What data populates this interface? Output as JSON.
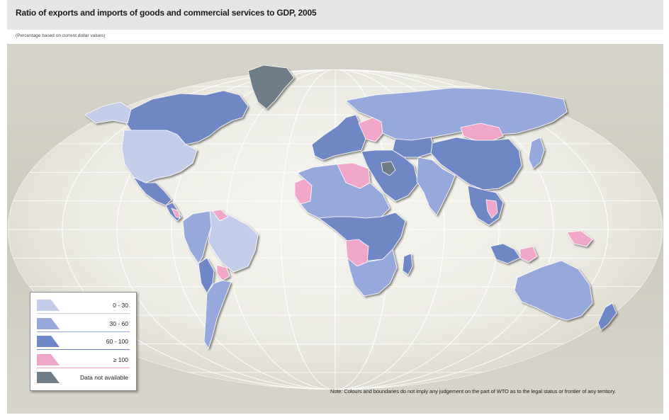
{
  "title": "Ratio of exports and imports of goods and commercial services to GDP, 2005",
  "subtitle": "(Percentage based on current dollar values)",
  "legend": [
    {
      "label": "0 - 30",
      "color": "#c3cdea"
    },
    {
      "label": "30 - 60",
      "color": "#97a9dc"
    },
    {
      "label": "60 - 100",
      "color": "#6f87c6"
    },
    {
      "label": "≥ 100",
      "color": "#f0a6c8"
    },
    {
      "label": "Data not available",
      "color": "#6e7d87"
    }
  ],
  "note": "Note: Colours and boundaries do not imply any judgement on the part of WTO as to the legal status or frontier of any territory.",
  "map": {
    "background": "#d4d1c6",
    "ocean_gradient_light": "#f4f3ee",
    "regions": [
      {
        "name": "greenland",
        "class": "Data not available"
      },
      {
        "name": "canada",
        "class": "60 - 100"
      },
      {
        "name": "alaska",
        "class": "0 - 30"
      },
      {
        "name": "united-states",
        "class": "0 - 30"
      },
      {
        "name": "mexico",
        "class": "60 - 100"
      },
      {
        "name": "central-america",
        "class": "60 - 100"
      },
      {
        "name": "central-america-high",
        "class": "≥ 100"
      },
      {
        "name": "brazil",
        "class": "0 - 30"
      },
      {
        "name": "south-america-west",
        "class": "30 - 60"
      },
      {
        "name": "andes",
        "class": "60 - 100"
      },
      {
        "name": "argentina",
        "class": "30 - 60"
      },
      {
        "name": "paraguay",
        "class": "≥ 100"
      },
      {
        "name": "guyana",
        "class": "≥ 100"
      },
      {
        "name": "europe-west",
        "class": "60 - 100"
      },
      {
        "name": "europe-east",
        "class": "≥ 100"
      },
      {
        "name": "russia",
        "class": "30 - 60"
      },
      {
        "name": "middle-east",
        "class": "60 - 100"
      },
      {
        "name": "iraq",
        "class": "Data not available"
      },
      {
        "name": "libya",
        "class": "≥ 100"
      },
      {
        "name": "mauritania",
        "class": "≥ 100"
      },
      {
        "name": "north-africa",
        "class": "30 - 60"
      },
      {
        "name": "central-africa",
        "class": "60 - 100"
      },
      {
        "name": "angola",
        "class": "≥ 100"
      },
      {
        "name": "southern-africa",
        "class": "30 - 60"
      },
      {
        "name": "madagascar",
        "class": "60 - 100"
      },
      {
        "name": "india",
        "class": "30 - 60"
      },
      {
        "name": "china",
        "class": "60 - 100"
      },
      {
        "name": "mongolia",
        "class": "≥ 100"
      },
      {
        "name": "central-asia",
        "class": "60 - 100"
      },
      {
        "name": "southeast-asia",
        "class": "60 - 100"
      },
      {
        "name": "thailand",
        "class": "≥ 100"
      },
      {
        "name": "malaysia",
        "class": "≥ 100"
      },
      {
        "name": "japan",
        "class": "30 - 60"
      },
      {
        "name": "indonesia",
        "class": "60 - 100"
      },
      {
        "name": "papua-new-guinea",
        "class": "≥ 100"
      },
      {
        "name": "australia",
        "class": "30 - 60"
      },
      {
        "name": "new-zealand",
        "class": "60 - 100"
      }
    ]
  }
}
